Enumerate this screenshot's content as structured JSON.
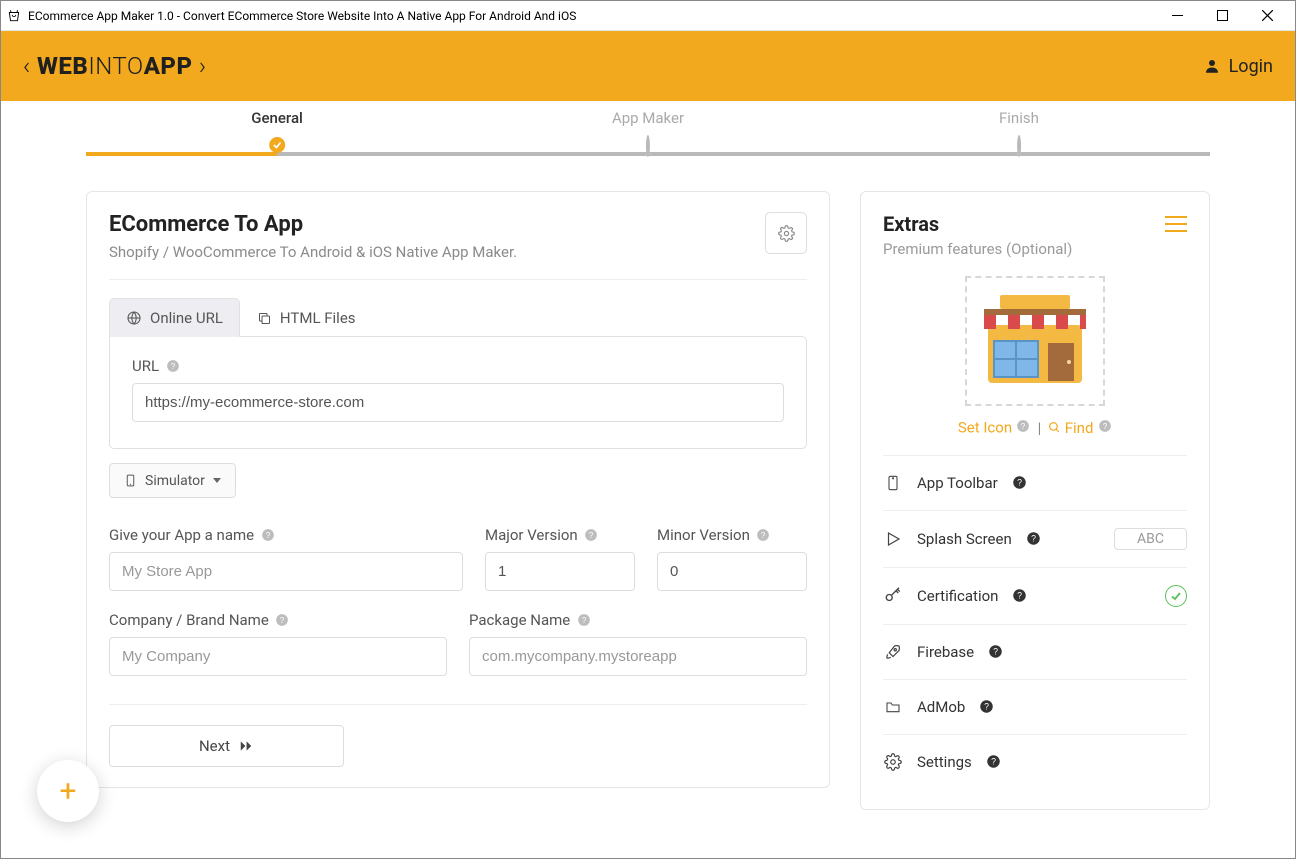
{
  "window": {
    "title": "ECommerce App Maker 1.0 - Convert ECommerce Store Website Into A Native App For Android And iOS"
  },
  "header": {
    "logo_left": "WEB",
    "logo_mid": "INTO",
    "logo_right": "APP",
    "login_label": "Login"
  },
  "stepper": {
    "steps": [
      {
        "label": "General",
        "active": true
      },
      {
        "label": "App Maker",
        "active": false
      },
      {
        "label": "Finish",
        "active": false
      }
    ]
  },
  "main": {
    "title": "ECommerce To App",
    "subtitle": "Shopify / WooCommerce To Android & iOS Native App Maker.",
    "tabs": [
      {
        "label": "Online URL",
        "active": true
      },
      {
        "label": "HTML Files",
        "active": false
      }
    ],
    "url_label": "URL",
    "url_value": "https://my-ecommerce-store.com",
    "simulator_label": "Simulator",
    "name_label": "Give your App a name",
    "name_placeholder": "My Store App",
    "major_label": "Major Version",
    "major_value": "1",
    "minor_label": "Minor Version",
    "minor_value": "0",
    "company_label": "Company / Brand Name",
    "company_placeholder": "My Company",
    "package_label": "Package Name",
    "package_placeholder": "com.mycompany.mystoreapp",
    "next_label": "Next"
  },
  "extras": {
    "title": "Extras",
    "subtitle": "Premium features (Optional)",
    "set_icon_label": "Set Icon",
    "find_label": "Find",
    "items": {
      "toolbar": "App Toolbar",
      "splash": "Splash Screen",
      "splash_badge": "ABC",
      "certification": "Certification",
      "firebase": "Firebase",
      "admob": "AdMob",
      "settings": "Settings"
    }
  },
  "fab_label": "+"
}
